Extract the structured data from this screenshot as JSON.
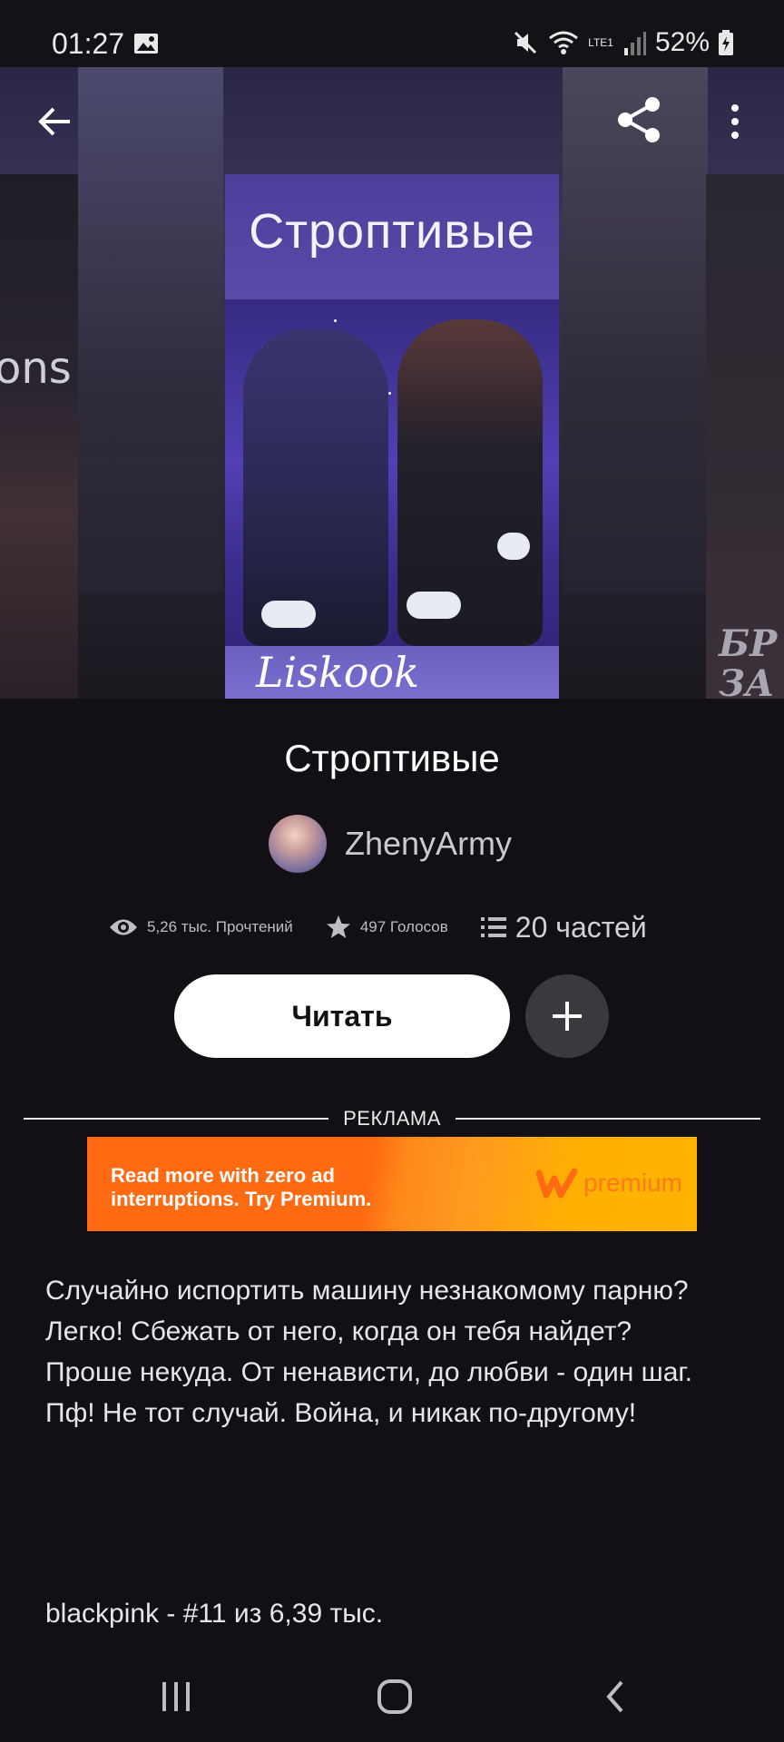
{
  "status_bar": {
    "time": "01:27",
    "battery": "52%",
    "network": "LTE1"
  },
  "book": {
    "title": "Строптивые",
    "cover_title": "Строптивые",
    "cover_author": "Liskook",
    "author": "ZhenyArmy"
  },
  "stats": {
    "reads": "5,26 тыс. Прочтений",
    "votes": "497 Голосов",
    "parts": "20 частей"
  },
  "actions": {
    "read_label": "Читать"
  },
  "ad": {
    "label": "РЕКЛАМА",
    "text_line1": "Read more with zero ad",
    "text_line2": "interruptions. Try Premium.",
    "brand": "premium"
  },
  "side_covers": {
    "left_text": "ons",
    "right_text_line1": "БР",
    "right_text_line2": "ЗА"
  },
  "description": {
    "lines": [
      "Случайно испортить машину незнакомому парню?",
      "Легко! Сбежать от него, когда он тебя найдет?",
      "Проше некуда. От ненависти, до любви - один шаг.",
      "Пф! Не тот случай. Война, и никак по-другому!"
    ]
  },
  "ranking": {
    "text": "blackpink  - #11 из 6,39 тыс."
  },
  "colors": {
    "background": "#121015",
    "button_primary": "#ffffff",
    "ad_orange": "#ff6a13"
  },
  "icons": {
    "back": "arrow-left-icon",
    "share": "share-icon",
    "more": "more-vertical-icon",
    "reads": "eye-icon",
    "votes": "star-icon",
    "parts": "list-icon",
    "add": "plus-icon"
  }
}
